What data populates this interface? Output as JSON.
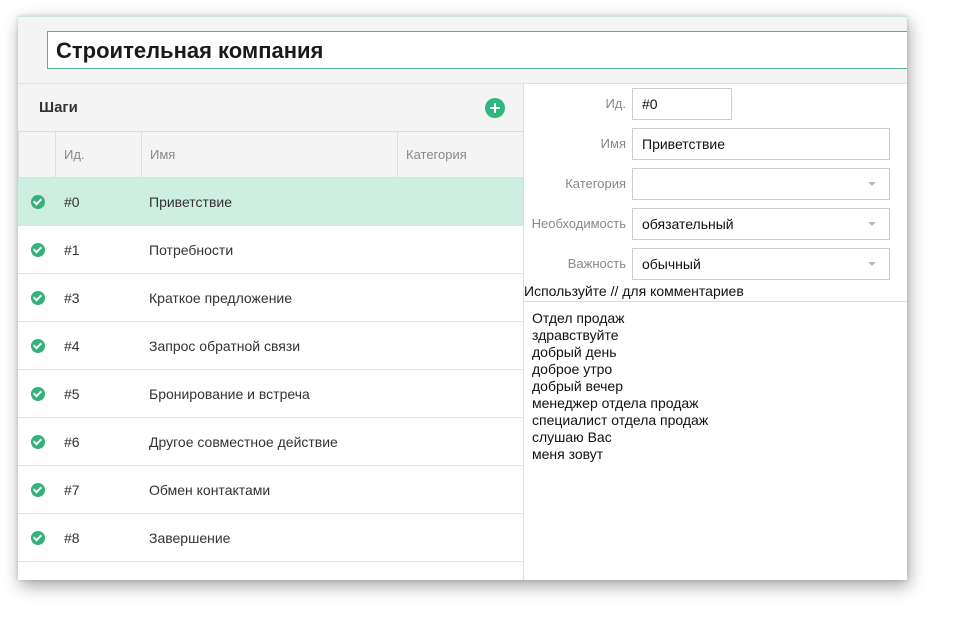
{
  "header": {
    "title": "Строительная компания"
  },
  "steps": {
    "title": "Шаги",
    "columns": [
      "Ид.",
      "Имя",
      "Категория"
    ],
    "rows": [
      {
        "id": "#0",
        "name": "Приветствие",
        "selected": true
      },
      {
        "id": "#1",
        "name": "Потребности"
      },
      {
        "id": "#3",
        "name": "Краткое предложение"
      },
      {
        "id": "#4",
        "name": "Запрос обратной связи"
      },
      {
        "id": "#5",
        "name": "Бронирование и встреча"
      },
      {
        "id": "#6",
        "name": "Другое совместное действие"
      },
      {
        "id": "#7",
        "name": "Обмен контактами"
      },
      {
        "id": "#8",
        "name": "Завершение"
      }
    ]
  },
  "form": {
    "id_label": "Ид.",
    "id_value": "#0",
    "name_label": "Имя",
    "name_value": "Приветствие",
    "category_label": "Категория",
    "category_value": "",
    "necessity_label": "Необходимость",
    "necessity_value": "обязательный",
    "importance_label": "Важность",
    "importance_value": "обычный",
    "hint": "Используйте // для комментариев",
    "comments": [
      "Отдел продаж",
      "здравствуйте",
      "добрый день",
      "доброе утро",
      "добрый вечер",
      "менеджер отдела продаж",
      "специалист отдела продаж",
      "слушаю Вас",
      "меня зовут"
    ]
  },
  "colors": {
    "accent": "#2db87d",
    "selected_row": "#cdeee0",
    "title_border": "#56b389"
  },
  "icons": {
    "add": "plus-circle-icon",
    "row_status": "check-circle-icon",
    "dropdown": "chevron-down-icon"
  }
}
